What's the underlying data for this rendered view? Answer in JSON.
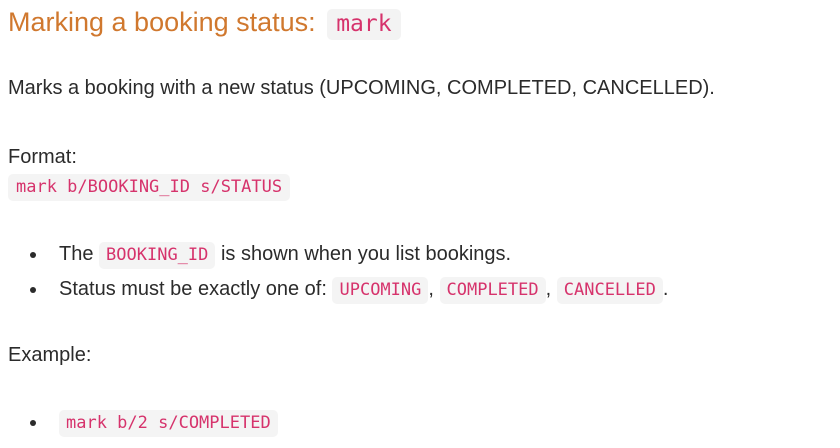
{
  "section": {
    "heading": "Marking a booking status:",
    "command": "mark"
  },
  "description": "Marks a booking with a new status (UPCOMING, COMPLETED, CANCELLED).",
  "format": {
    "label": "Format:",
    "syntax": "mark b/BOOKING_ID s/STATUS"
  },
  "notes": [
    {
      "prefix": "The",
      "code": "BOOKING_ID",
      "suffix": "is shown when you list bookings."
    },
    {
      "prefix": "Status must be exactly one of:",
      "codes": [
        "UPCOMING",
        "COMPLETED",
        "CANCELLED"
      ],
      "separator": ",",
      "end": "."
    }
  ],
  "example": {
    "label": "Example:",
    "items": [
      "mark b/2 s/COMPLETED"
    ]
  }
}
